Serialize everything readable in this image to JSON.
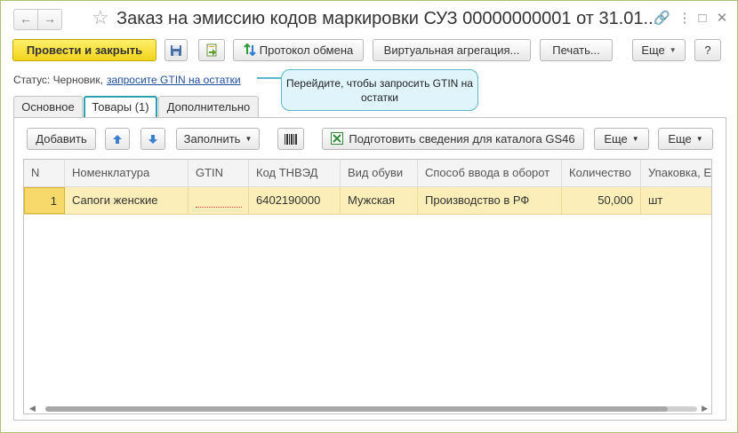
{
  "title": "Заказ на эмиссию кодов маркировки СУЗ 00000000001 от 31.01....",
  "icons": {
    "back": "arrow-left-icon",
    "forward": "arrow-right-icon",
    "favorite": "star-icon",
    "link": "link-icon",
    "menu": "more-vertical-icon",
    "maximize": "maximize-icon",
    "close": "close-icon"
  },
  "toolbar": {
    "post_close": "Провести и закрыть",
    "exchange_log": "Протокол обмена",
    "virtual_aggregation": "Виртуальная агрегация...",
    "print": "Печать...",
    "more": "Еще",
    "help": "?"
  },
  "status": {
    "label": "Статус:",
    "value": "Черновик,",
    "link": "запросите GTIN на остатки"
  },
  "tooltip": "Перейдите, чтобы запросить GTIN на остатки",
  "tabs": [
    {
      "label": "Основное"
    },
    {
      "label": "Товары (1)"
    },
    {
      "label": "Дополнительно"
    }
  ],
  "goods_toolbar": {
    "add": "Добавить",
    "fill": "Заполнить",
    "prepare_gs46": "Подготовить сведения для каталога GS46",
    "more1": "Еще",
    "more2": "Еще"
  },
  "table": {
    "columns": [
      "N",
      "Номенклатура",
      "GTIN",
      "Код ТНВЭД",
      "Вид обуви",
      "Способ ввода в оборот",
      "Количество",
      "Упаковка, Е"
    ],
    "rows": [
      {
        "n": "1",
        "nomenclature": "Сапоги женские",
        "gtin": "",
        "tnved": "6402190000",
        "shoe_type": "Мужская",
        "input_method": "Производство в РФ",
        "quantity": "50,000",
        "package": "шт"
      }
    ]
  }
}
